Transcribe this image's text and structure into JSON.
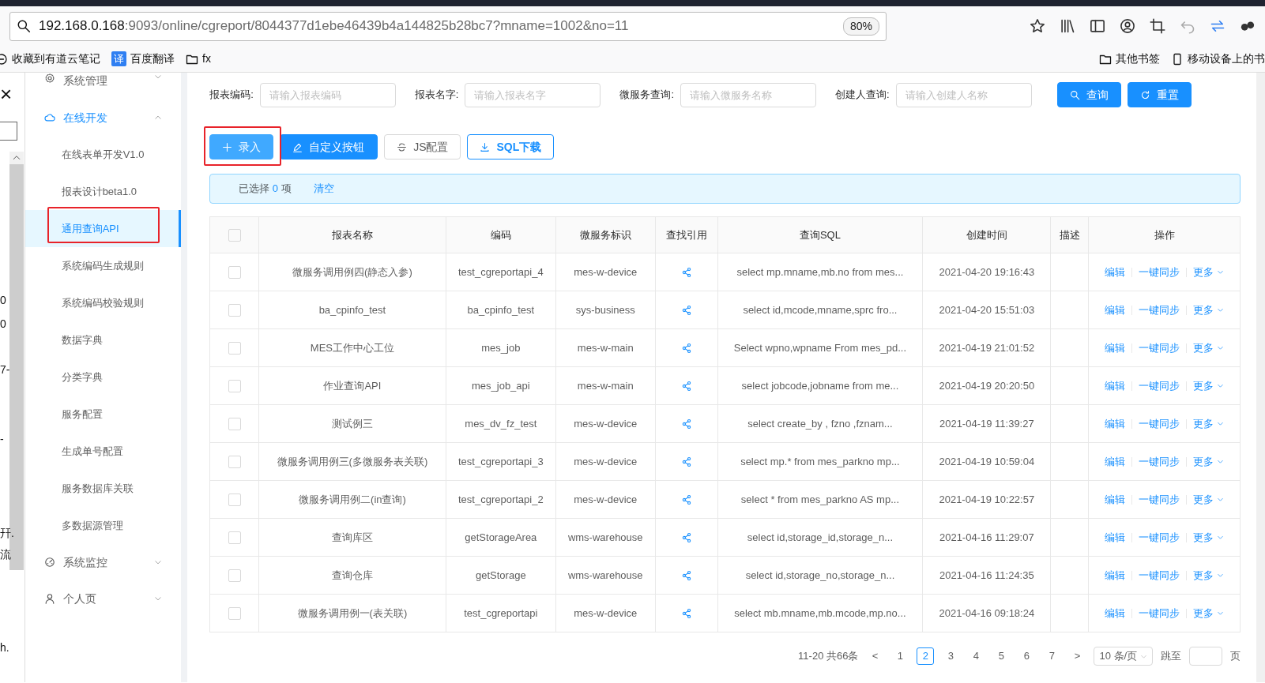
{
  "browser": {
    "url_host": "192.168.0.168",
    "url_rest": ":9093/online/cgreport/8044377d1ebe46439b4a144825b28bc7?mname=1002&no=11",
    "zoom": "80%",
    "bookmarks": [
      {
        "label": "收藏到有道云笔记",
        "kind": "note"
      },
      {
        "label": "百度翻译",
        "kind": "translate",
        "glyph": "译"
      },
      {
        "label": "fx",
        "kind": "folder"
      }
    ],
    "right_bookmarks": [
      {
        "label": "其他书签",
        "kind": "folder"
      },
      {
        "label": "移动设备上的书",
        "kind": "mobile"
      }
    ]
  },
  "left_panel": {
    "close": "×",
    "fragments": [
      "0",
      "0",
      "7-",
      "-",
      "幵.",
      "流",
      "h."
    ]
  },
  "sidebar": {
    "items": [
      {
        "label": "系统管理",
        "expanded": false
      },
      {
        "label": "在线开发",
        "expanded": true,
        "children": [
          {
            "label": "在线表单开发V1.0",
            "selected": false,
            "highlighted": false
          },
          {
            "label": "报表设计beta1.0",
            "selected": false,
            "highlighted": false
          },
          {
            "label": "通用查询API",
            "selected": true,
            "highlighted": true
          },
          {
            "label": "系统编码生成规则",
            "selected": false,
            "highlighted": false
          },
          {
            "label": "系统编码校验规则",
            "selected": false,
            "highlighted": false
          },
          {
            "label": "数据字典",
            "selected": false,
            "highlighted": false
          },
          {
            "label": "分类字典",
            "selected": false,
            "highlighted": false
          },
          {
            "label": "服务配置",
            "selected": false,
            "highlighted": false
          },
          {
            "label": "生成单号配置",
            "selected": false,
            "highlighted": false
          },
          {
            "label": "服务数据库关联",
            "selected": false,
            "highlighted": false
          },
          {
            "label": "多数据源管理",
            "selected": false,
            "highlighted": false
          }
        ]
      },
      {
        "label": "系统监控",
        "expanded": false
      },
      {
        "label": "个人页",
        "expanded": false
      }
    ]
  },
  "filters": [
    {
      "label": "报表编码:",
      "placeholder": "请输入报表编码"
    },
    {
      "label": "报表名字:",
      "placeholder": "请输入报表名字"
    },
    {
      "label": "微服务查询:",
      "placeholder": "请输入微服务名称"
    },
    {
      "label": "创建人查询:",
      "placeholder": "请输入创建人名称"
    }
  ],
  "filter_buttons": [
    {
      "label": "查询",
      "kind": "search"
    },
    {
      "label": "重置",
      "kind": "reset"
    }
  ],
  "toolbar": [
    {
      "label": "录入",
      "kind": "add",
      "highlighted": true
    },
    {
      "label": "自定义按钮",
      "kind": "custom",
      "highlighted": false
    },
    {
      "label": "JS配置",
      "kind": "js",
      "highlighted": false
    },
    {
      "label": "SQL下载",
      "kind": "download",
      "highlighted": false
    }
  ],
  "selection_alert": {
    "prefix": "已选择",
    "count": "0",
    "suffix": "项",
    "clear": "清空"
  },
  "table": {
    "all_checked": false,
    "columns": [
      "报表名称",
      "编码",
      "微服务标识",
      "查找引用",
      "查询SQL",
      "创建时间",
      "描述",
      "操作"
    ],
    "rows": [
      {
        "checked": false,
        "name": "微服务调用例四(静态入参)",
        "code": "test_cgreportapi_4",
        "service": "mes-w-device",
        "sql": "select mp.mname,mb.no from mes...",
        "created": "2021-04-20 19:16:43",
        "actions": [
          "编辑",
          "一键同步",
          "更多"
        ]
      },
      {
        "checked": false,
        "name": "ba_cpinfo_test",
        "code": "ba_cpinfo_test",
        "service": "sys-business",
        "sql": "select id,mcode,mname,sprc fro...",
        "created": "2021-04-20 15:51:03",
        "actions": [
          "编辑",
          "一键同步",
          "更多"
        ]
      },
      {
        "checked": false,
        "name": "MES工作中心工位",
        "code": "mes_job",
        "service": "mes-w-main",
        "sql": "Select wpno,wpname From mes_pd...",
        "created": "2021-04-19 21:01:52",
        "actions": [
          "编辑",
          "一键同步",
          "更多"
        ]
      },
      {
        "checked": false,
        "name": "作业查询API",
        "code": "mes_job_api",
        "service": "mes-w-main",
        "sql": "select jobcode,jobname from me...",
        "created": "2021-04-19 20:20:50",
        "actions": [
          "编辑",
          "一键同步",
          "更多"
        ]
      },
      {
        "checked": false,
        "name": "测试例三",
        "code": "mes_dv_fz_test",
        "service": "mes-w-device",
        "sql": "select create_by , fzno ,fznam...",
        "created": "2021-04-19 11:39:27",
        "actions": [
          "编辑",
          "一键同步",
          "更多"
        ]
      },
      {
        "checked": false,
        "name": "微服务调用例三(多微服务表关联)",
        "code": "test_cgreportapi_3",
        "service": "mes-w-device",
        "sql": "select mp.* from mes_parkno mp...",
        "created": "2021-04-19 10:59:04",
        "actions": [
          "编辑",
          "一键同步",
          "更多"
        ]
      },
      {
        "checked": false,
        "name": "微服务调用例二(in查询)",
        "code": "test_cgreportapi_2",
        "service": "mes-w-device",
        "sql": "select * from mes_parkno AS mp...",
        "created": "2021-04-19 10:22:57",
        "actions": [
          "编辑",
          "一键同步",
          "更多"
        ]
      },
      {
        "checked": false,
        "name": "查询库区",
        "code": "getStorageArea",
        "service": "wms-warehouse",
        "sql": "select id,storage_id,storage_n...",
        "created": "2021-04-16 11:29:07",
        "actions": [
          "编辑",
          "一键同步",
          "更多"
        ]
      },
      {
        "checked": false,
        "name": "查询仓库",
        "code": "getStorage",
        "service": "wms-warehouse",
        "sql": "select id,storage_no,storage_n...",
        "created": "2021-04-16 11:24:35",
        "actions": [
          "编辑",
          "一键同步",
          "更多"
        ]
      },
      {
        "checked": false,
        "name": "微服务调用例一(表关联)",
        "code": "test_cgreportapi",
        "service": "mes-w-device",
        "sql": "select mb.mname,mb.mcode,mp.no...",
        "created": "2021-04-16 09:18:24",
        "actions": [
          "编辑",
          "一键同步",
          "更多"
        ]
      }
    ]
  },
  "pagination": {
    "summary": "11-20 共66条",
    "prev": "<",
    "next": ">",
    "pages": [
      {
        "label": "1",
        "selected": false
      },
      {
        "label": "2",
        "selected": true
      },
      {
        "label": "3",
        "selected": false
      },
      {
        "label": "4",
        "selected": false
      },
      {
        "label": "5",
        "selected": false
      },
      {
        "label": "6",
        "selected": false
      },
      {
        "label": "7",
        "selected": false
      }
    ],
    "page_size": "10 条/页",
    "jump_label": "跳至",
    "jump_suffix": "页"
  }
}
